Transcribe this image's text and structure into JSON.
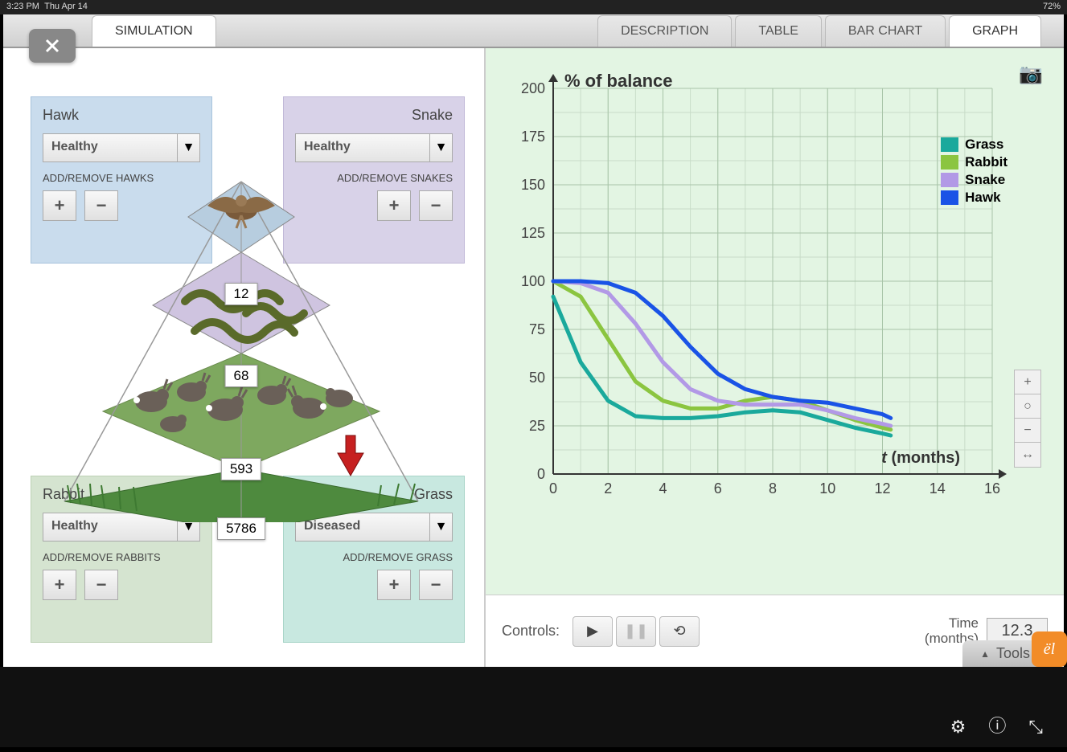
{
  "statusbar": {
    "time": "3:23 PM",
    "date": "Thu Apr 14",
    "battery": "72%"
  },
  "tabs": {
    "simulation": "SIMULATION",
    "description": "DESCRIPTION",
    "table": "TABLE",
    "barchart": "BAR CHART",
    "graph": "GRAPH"
  },
  "species": {
    "hawk": {
      "name": "Hawk",
      "status": "Healthy",
      "add_remove_label": "ADD/REMOVE HAWKS",
      "count": "12"
    },
    "snake": {
      "name": "Snake",
      "status": "Healthy",
      "add_remove_label": "ADD/REMOVE SNAKES",
      "count": "68"
    },
    "rabbit": {
      "name": "Rabbit",
      "status": "Healthy",
      "add_remove_label": "ADD/REMOVE RABBITS",
      "count": "593"
    },
    "grass": {
      "name": "Grass",
      "status": "Diseased",
      "add_remove_label": "ADD/REMOVE GRASS",
      "count": "5786"
    }
  },
  "graph": {
    "title": "% of balance",
    "x_label": "t (months)",
    "legend": {
      "grass": "Grass",
      "rabbit": "Rabbit",
      "snake": "Snake",
      "hawk": "Hawk"
    }
  },
  "chart_data": {
    "type": "line",
    "xlabel": "t (months)",
    "ylabel": "% of balance",
    "xlim": [
      0,
      16
    ],
    "ylim": [
      0,
      200
    ],
    "x": [
      0,
      1,
      2,
      3,
      4,
      5,
      6,
      7,
      8,
      9,
      10,
      11,
      12,
      12.3
    ],
    "series": [
      {
        "name": "Grass",
        "color": "#1aa99c",
        "values": [
          92,
          58,
          38,
          30,
          29,
          29,
          30,
          32,
          33,
          32,
          28,
          24,
          21,
          20
        ]
      },
      {
        "name": "Rabbit",
        "color": "#8bc540",
        "values": [
          100,
          92,
          70,
          48,
          38,
          34,
          34,
          38,
          40,
          38,
          33,
          28,
          24,
          23
        ]
      },
      {
        "name": "Snake",
        "color": "#b299e6",
        "values": [
          100,
          99,
          94,
          78,
          58,
          44,
          38,
          36,
          36,
          36,
          33,
          29,
          26,
          25
        ]
      },
      {
        "name": "Hawk",
        "color": "#1a53e6",
        "values": [
          100,
          100,
          99,
          94,
          82,
          66,
          52,
          44,
          40,
          38,
          37,
          34,
          31,
          29
        ]
      }
    ]
  },
  "controls": {
    "label": "Controls:",
    "time_label_1": "Time",
    "time_label_2": "(months)",
    "time_value": "12.3"
  },
  "tools_label": "Tools",
  "buttons": {
    "plus": "+",
    "minus": "−"
  }
}
